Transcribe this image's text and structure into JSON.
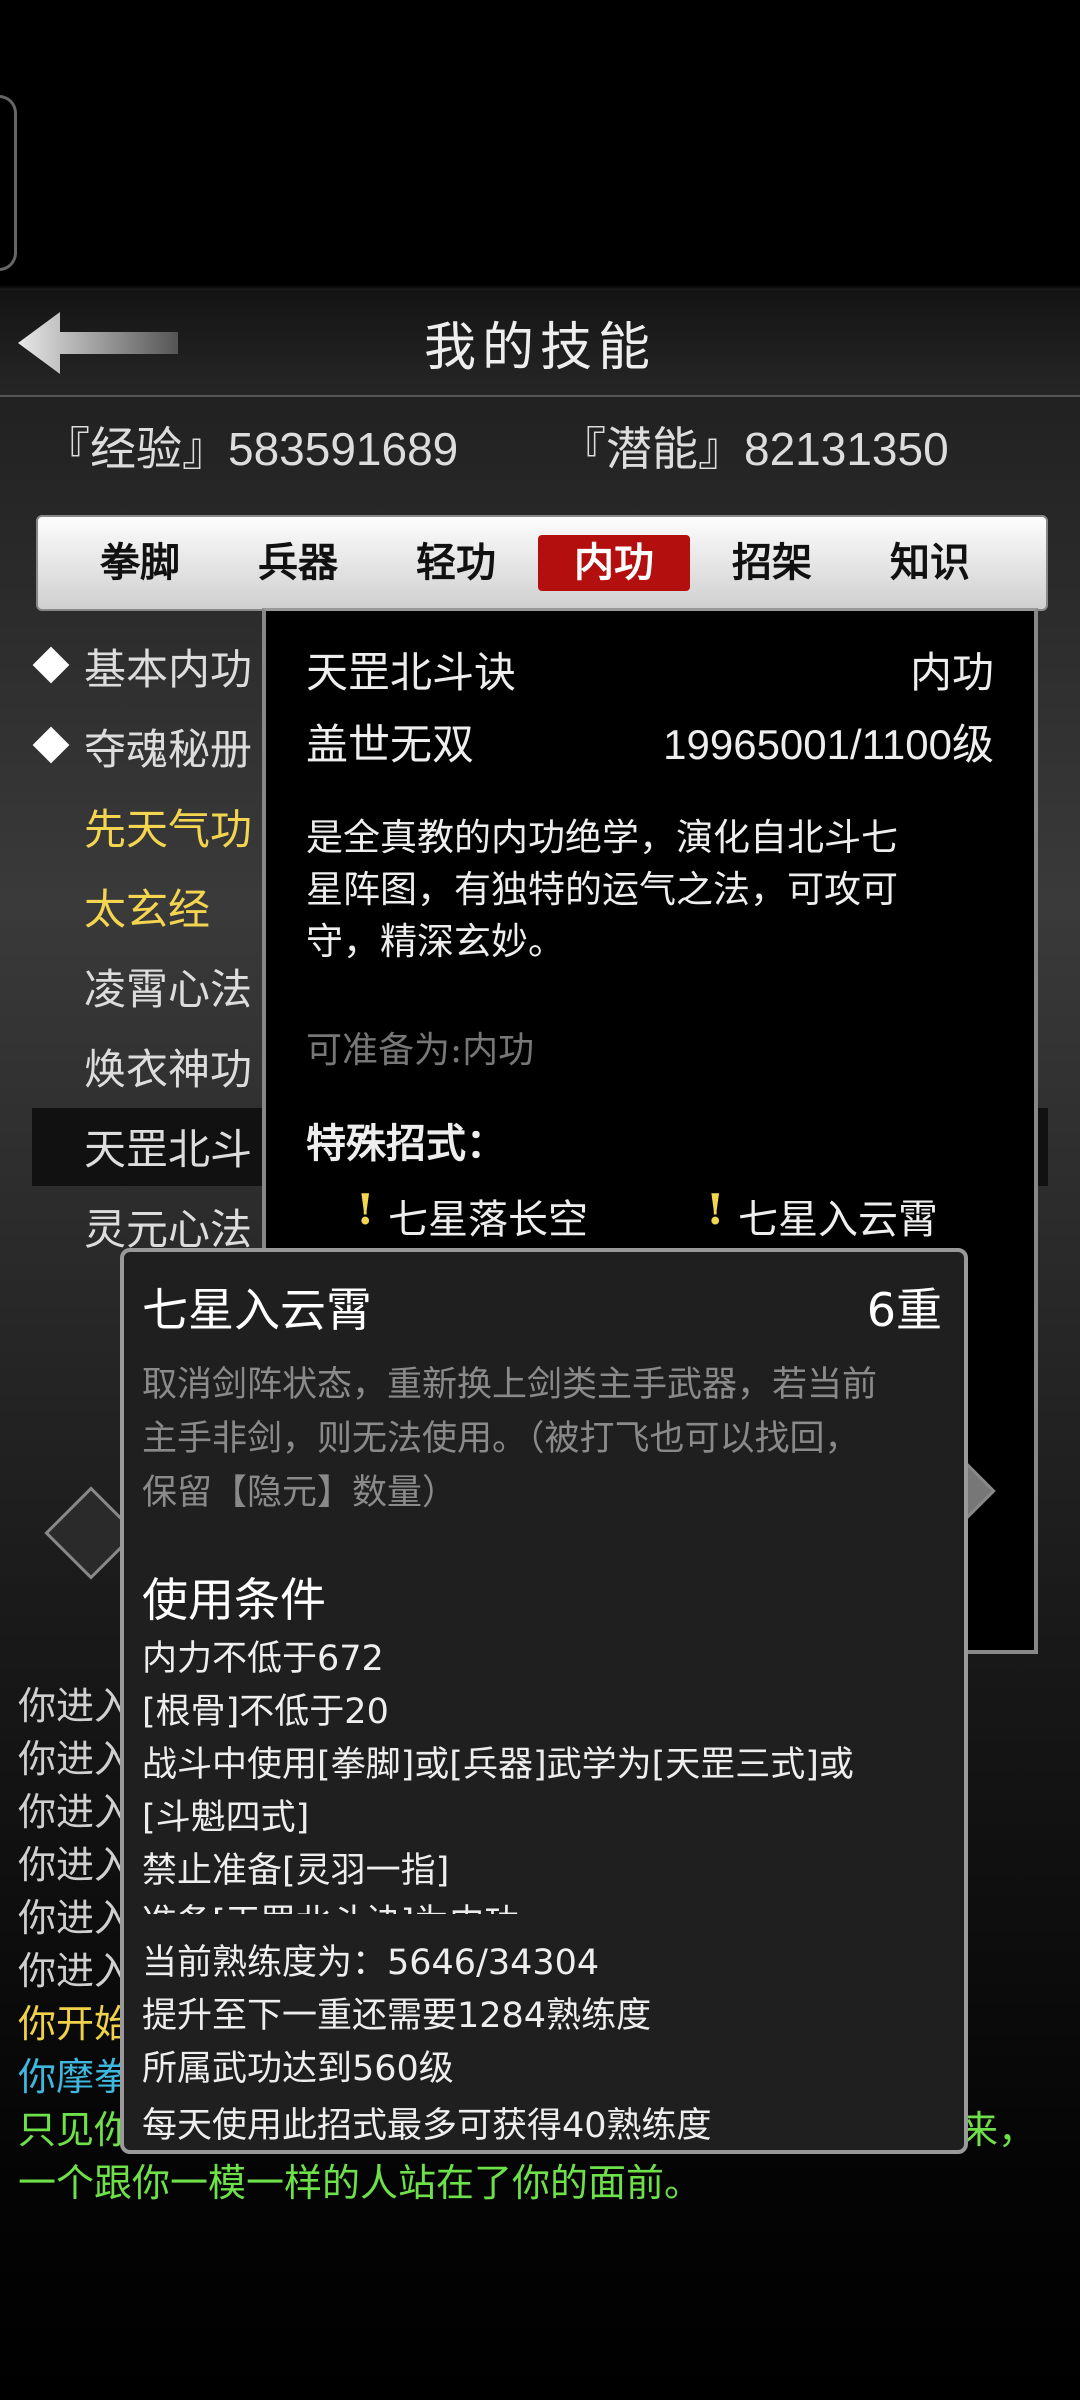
{
  "header": {
    "title": "我的技能"
  },
  "stats": {
    "exp": "『经验』583591689",
    "potential": "『潜能』82131350"
  },
  "tabs": [
    "拳脚",
    "兵器",
    "轻功",
    "内功",
    "招架",
    "知识"
  ],
  "skill_list": [
    {
      "label": "基本内功",
      "diamond": true,
      "color": "white"
    },
    {
      "label": "夺魂秘册",
      "diamond": true,
      "color": "white"
    },
    {
      "label": "先天气功",
      "diamond": false,
      "color": "gold"
    },
    {
      "label": "太玄经",
      "diamond": false,
      "color": "gold"
    },
    {
      "label": "凌霄心法",
      "diamond": false,
      "color": "white"
    },
    {
      "label": "焕衣神功",
      "diamond": false,
      "color": "white"
    },
    {
      "label": "天罡北斗",
      "diamond": false,
      "color": "white",
      "selected": true
    },
    {
      "label": "灵元心法",
      "diamond": false,
      "color": "white"
    }
  ],
  "detail": {
    "name": "天罡北斗诀",
    "type": "内功",
    "rank": "盖世无双",
    "level": "19965001/1100级",
    "description_lines": [
      "是全真教的内功绝学，演化自北斗七",
      "星阵图，有独特的运气之法，可攻可",
      "守，精深玄妙。"
    ],
    "prepare": "可准备为:内功",
    "special_heading": "特殊招式：",
    "moves": [
      "七星落长空",
      "七星入云霄"
    ]
  },
  "log_lines": [
    {
      "text": "你进入",
      "color": "#cfcfcf"
    },
    {
      "text": "你进入",
      "color": "#cfcfcf"
    },
    {
      "text": "你进入",
      "color": "#cfcfcf"
    },
    {
      "text": "你进入",
      "color": "#cfcfcf"
    },
    {
      "text": "你进入",
      "color": "#cfcfcf"
    },
    {
      "text": "你进入",
      "color": "#cfcfcf"
    },
    {
      "text": "你开始",
      "color": "#f0d24a"
    },
    {
      "text": "你摩拳",
      "color": "#3fb8e0"
    },
    {
      "text": "只见你",
      "color": "#6ee04a"
    }
  ],
  "log_tail": "来，",
  "log_last": "一个跟你一模一样的人站在了你的面前。",
  "popup": {
    "title": "七星入云霄",
    "tier": "6重",
    "desc_lines": [
      "取消剑阵状态，重新换上剑类主手武器，若当前",
      "主手非剑，则无法使用。（被打飞也可以找回，",
      "保留【隐元】数量）"
    ],
    "conditions_heading": "使用条件",
    "conditions": [
      "内力不低于672",
      "[根骨]不低于20",
      "战斗中使用[拳脚]或[兵器]武学为[天罡三式]或",
      "[斗魁四式]",
      "禁止准备[灵羽一指]",
      "准备[天罡北斗诀]为内功"
    ],
    "proficiency": "当前熟练度为：5646/34304",
    "next_tier": "提升至下一重还需要1284熟练度",
    "required_level": "所属武功达到560级",
    "daily_cap": "每天使用此招式最多可获得40熟练度"
  },
  "colors": {
    "accent_red": "#b40f0f",
    "gold": "#f3d550"
  }
}
